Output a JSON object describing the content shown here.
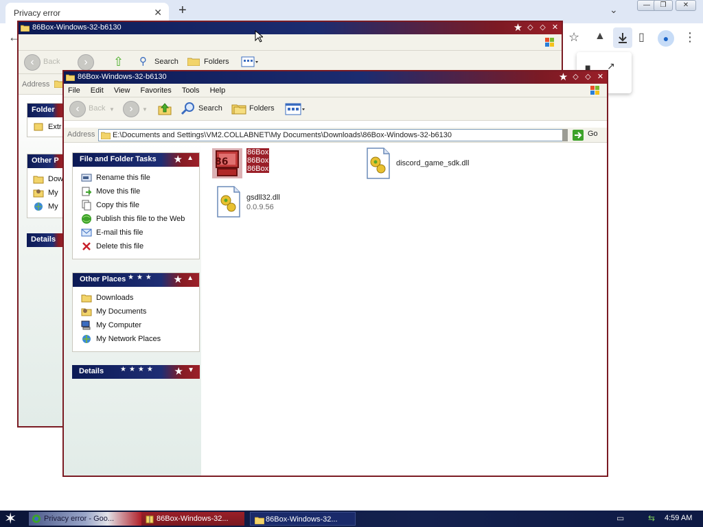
{
  "browser": {
    "tab_title": "Privacy error",
    "tab_close": "✕",
    "new_tab": "+",
    "tab_search": "⌄",
    "window_controls": [
      "—",
      "❐",
      "✕"
    ],
    "toolbar_icons": [
      "star-icon",
      "labs-icon",
      "download-icon",
      "sidebar-icon",
      "profile-icon",
      "more-icon"
    ]
  },
  "back_window": {
    "title": "86Box-Windows-32-b6130",
    "toolbar": {
      "back": "Back",
      "search": "Search",
      "folders": "Folders"
    },
    "address_label": "Address",
    "panels": [
      {
        "title": "Folder",
        "items": [
          "Extr"
        ]
      },
      {
        "title": "Other P",
        "items": [
          "Dow",
          "My",
          "My"
        ]
      },
      {
        "title": "Details",
        "items": []
      }
    ]
  },
  "front_window": {
    "title": "86Box-Windows-32-b6130",
    "menu": [
      "File",
      "Edit",
      "View",
      "Favorites",
      "Tools",
      "Help"
    ],
    "toolbar": {
      "back": "Back",
      "search": "Search",
      "folders": "Folders"
    },
    "address": {
      "label": "Address",
      "path": "E:\\Documents and Settings\\VM2.COLLABNET\\My Documents\\Downloads\\86Box-Windows-32-b6130",
      "go": "Go"
    },
    "panels": {
      "file_tasks": {
        "title": "File and Folder Tasks",
        "items": [
          {
            "label": "Rename this file",
            "icon": "rename-icon"
          },
          {
            "label": "Move this file",
            "icon": "move-icon"
          },
          {
            "label": "Copy this file",
            "icon": "copy-icon"
          },
          {
            "label": "Publish this file to the Web",
            "icon": "publish-web-icon"
          },
          {
            "label": "E-mail this file",
            "icon": "email-icon"
          },
          {
            "label": "Delete this file",
            "icon": "delete-icon"
          }
        ]
      },
      "other_places": {
        "title": "Other Places",
        "items": [
          {
            "label": "Downloads",
            "icon": "folder-icon"
          },
          {
            "label": "My Documents",
            "icon": "my-documents-icon"
          },
          {
            "label": "My Computer",
            "icon": "my-computer-icon"
          },
          {
            "label": "My Network Places",
            "icon": "network-places-icon"
          }
        ]
      },
      "details": {
        "title": "Details"
      }
    },
    "files": [
      {
        "name_lines": [
          "86Box",
          "86Box",
          "86Box"
        ],
        "icon": "86box-exe-icon",
        "selected": true
      },
      {
        "name": "discord_game_sdk.dll",
        "icon": "dll-icon"
      },
      {
        "name": "gsdll32.dll",
        "version": "0.0.9.56",
        "icon": "dll-icon"
      }
    ]
  },
  "taskbar": {
    "buttons": [
      "Privacy error - Goo...",
      "86Box-Windows-32...",
      "86Box-Windows-32..."
    ],
    "clock": "4:59 AM"
  },
  "colors": {
    "titlebar_navy": "#0c1a55",
    "titlebar_red": "#9a1f28",
    "selection": "#9a1f28"
  }
}
